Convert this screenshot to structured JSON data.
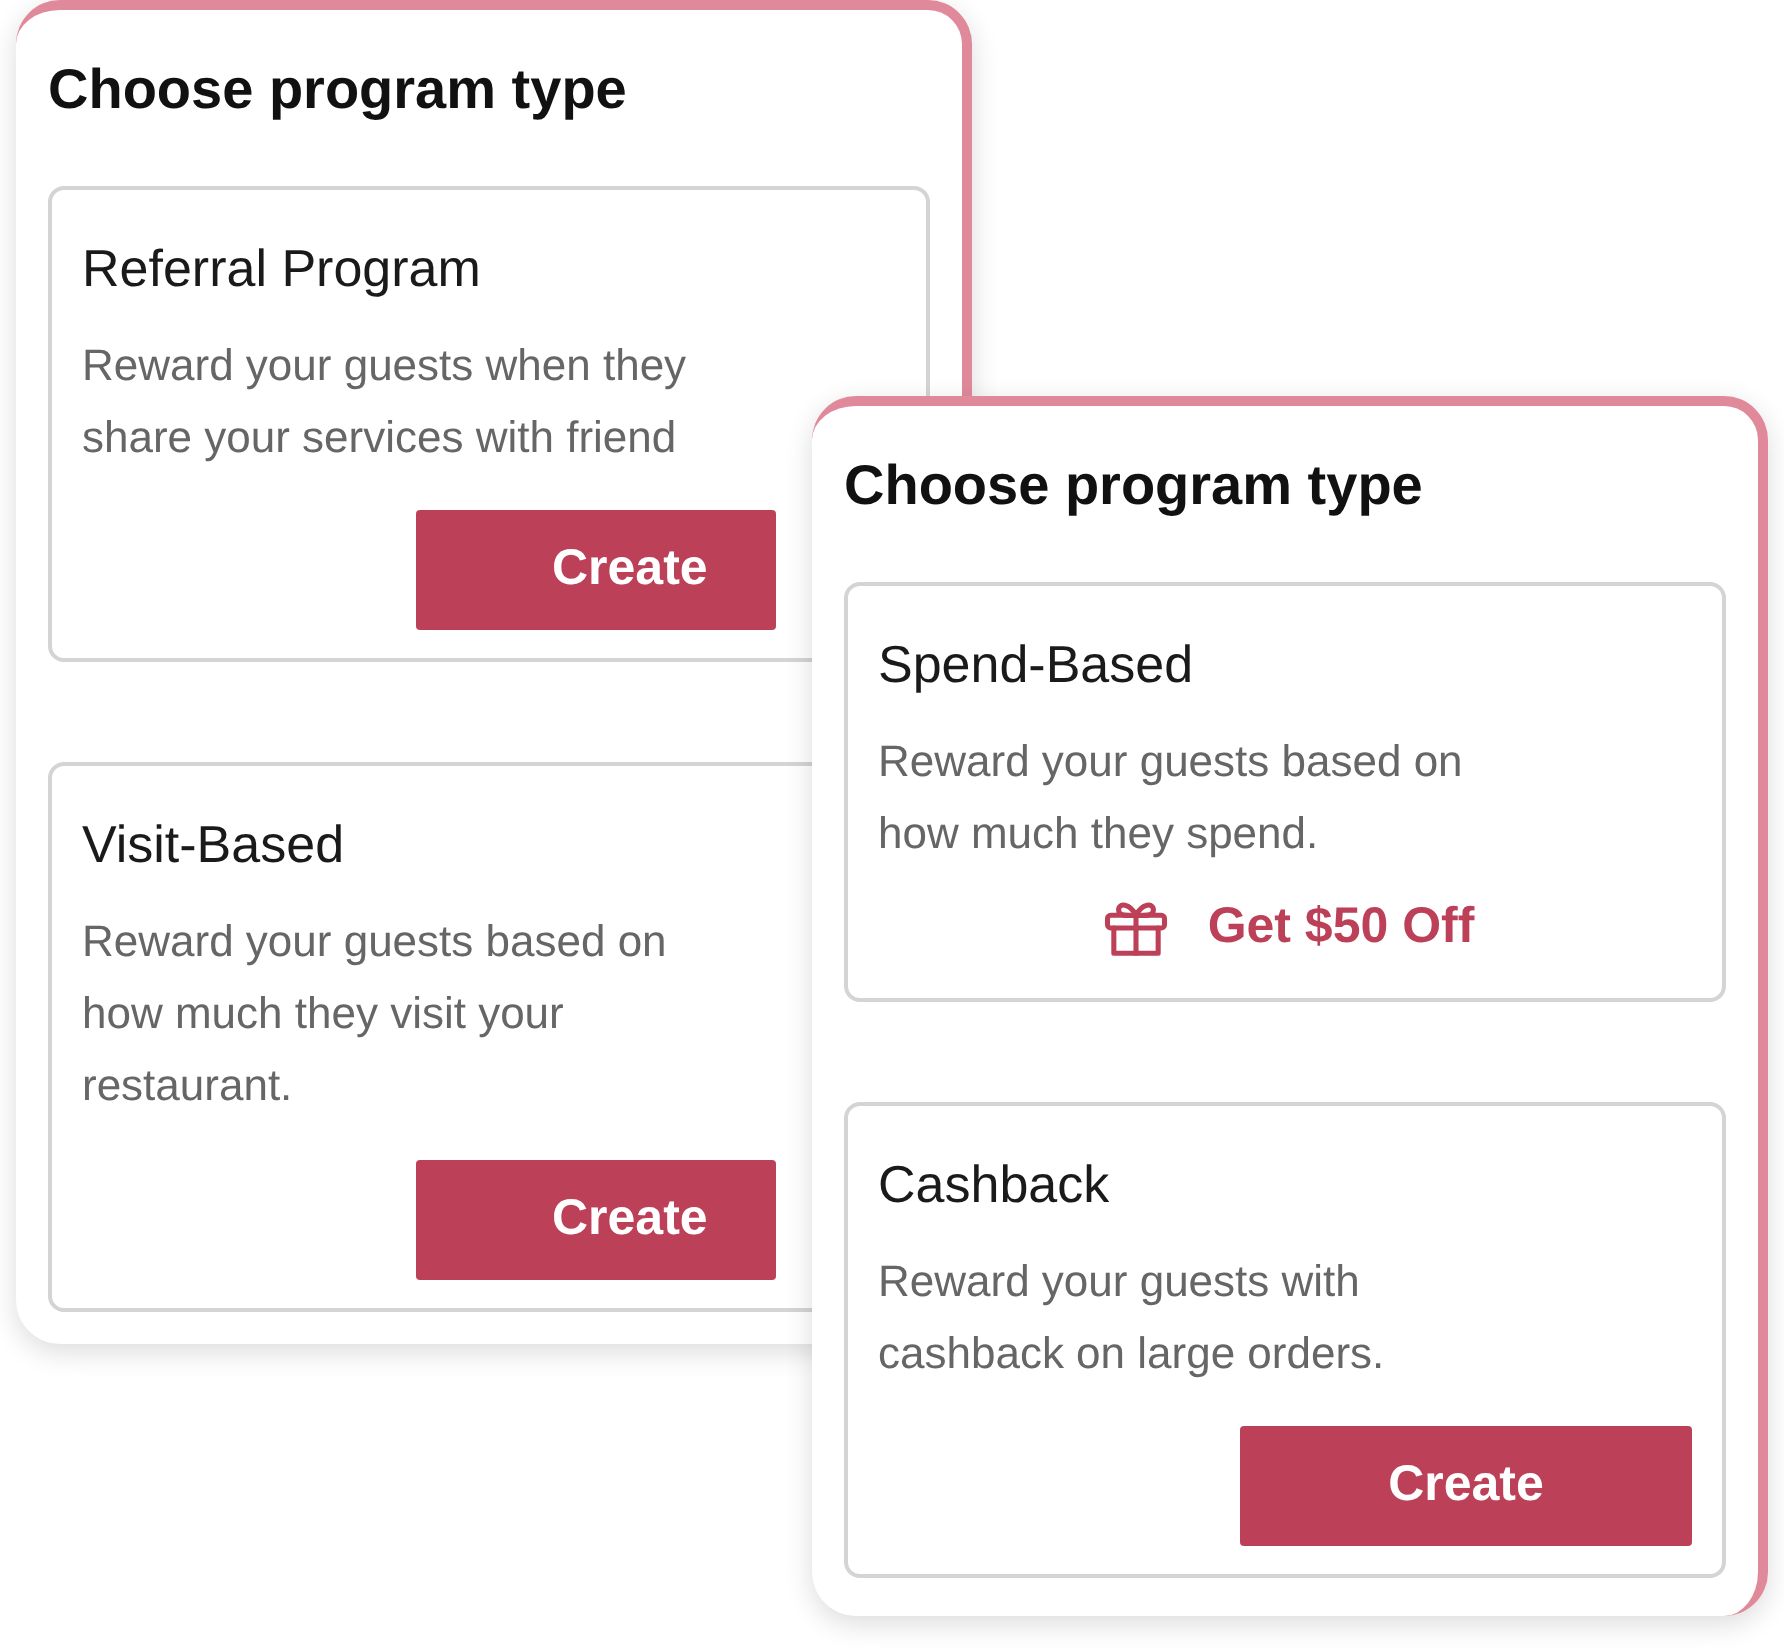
{
  "panels": [
    {
      "title": "Choose program type",
      "cards": [
        {
          "title": "Referral Program",
          "description": "Reward your guests when they share your services with friend",
          "action": {
            "kind": "button",
            "label": "Create"
          }
        },
        {
          "title": "Visit-Based",
          "description": "Reward your guests based on how much they visit your restaurant.",
          "action": {
            "kind": "button",
            "label": "Create"
          }
        }
      ]
    },
    {
      "title": "Choose program type",
      "cards": [
        {
          "title": "Spend-Based",
          "description": "Reward your guests based on how much they spend.",
          "action": {
            "kind": "offer",
            "label": "Get $50 Off"
          }
        },
        {
          "title": "Cashback",
          "description": "Reward your guests with cashback on large orders.",
          "action": {
            "kind": "button",
            "label": "Create"
          }
        }
      ]
    }
  ]
}
